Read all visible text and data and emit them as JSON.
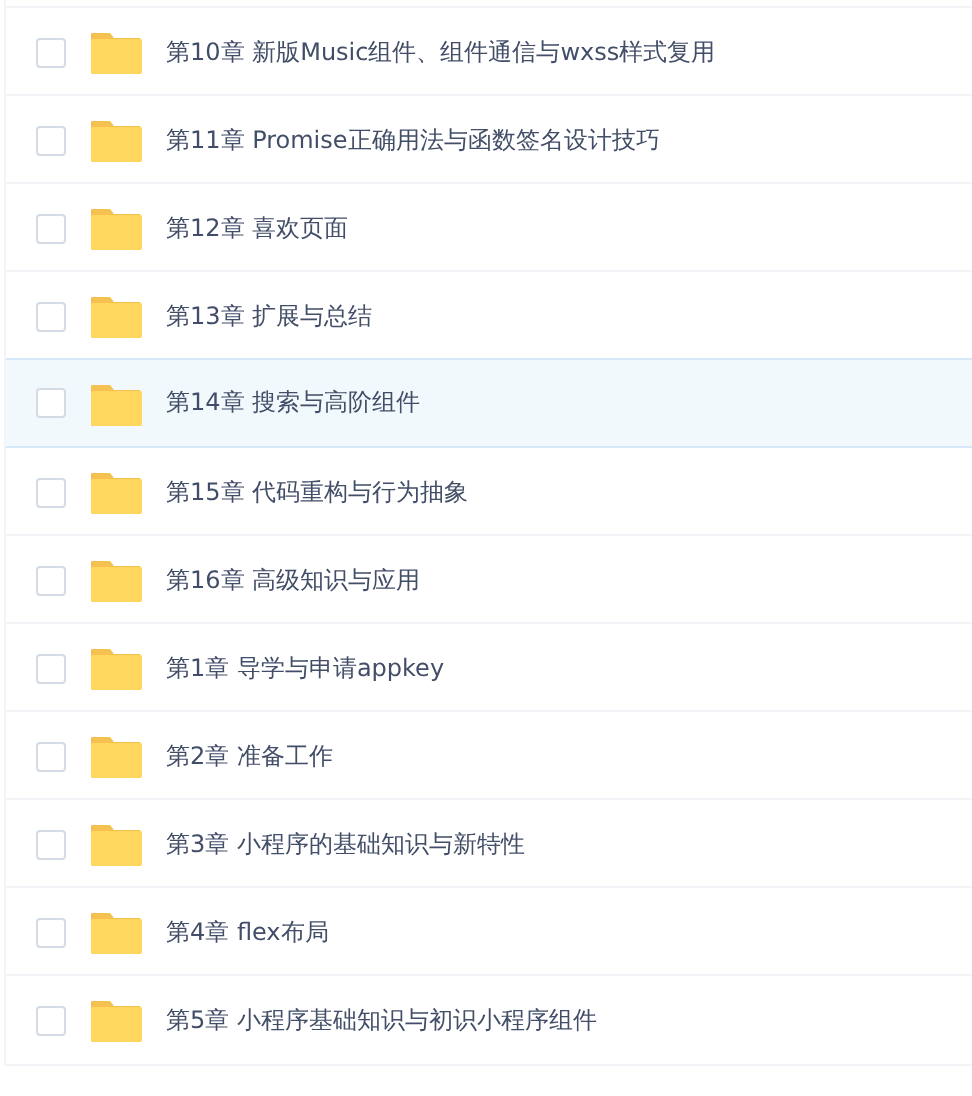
{
  "files": [
    {
      "name": "第10章 新版Music组件、组件通信与wxss样式复用",
      "checked": false,
      "selected": false
    },
    {
      "name": "第11章 Promise正确用法与函数签名设计技巧",
      "checked": false,
      "selected": false
    },
    {
      "name": "第12章 喜欢页面",
      "checked": false,
      "selected": false
    },
    {
      "name": "第13章 扩展与总结",
      "checked": false,
      "selected": false
    },
    {
      "name": "第14章 搜索与高阶组件",
      "checked": false,
      "selected": true
    },
    {
      "name": "第15章 代码重构与行为抽象",
      "checked": false,
      "selected": false
    },
    {
      "name": "第16章 高级知识与应用",
      "checked": false,
      "selected": false
    },
    {
      "name": "第1章 导学与申请appkey",
      "checked": false,
      "selected": false
    },
    {
      "name": "第2章 准备工作",
      "checked": false,
      "selected": false
    },
    {
      "name": "第3章 小程序的基础知识与新特性",
      "checked": false,
      "selected": false
    },
    {
      "name": "第4章 flex布局",
      "checked": false,
      "selected": false
    },
    {
      "name": "第5章 小程序基础知识与初识小程序组件",
      "checked": false,
      "selected": false
    }
  ]
}
